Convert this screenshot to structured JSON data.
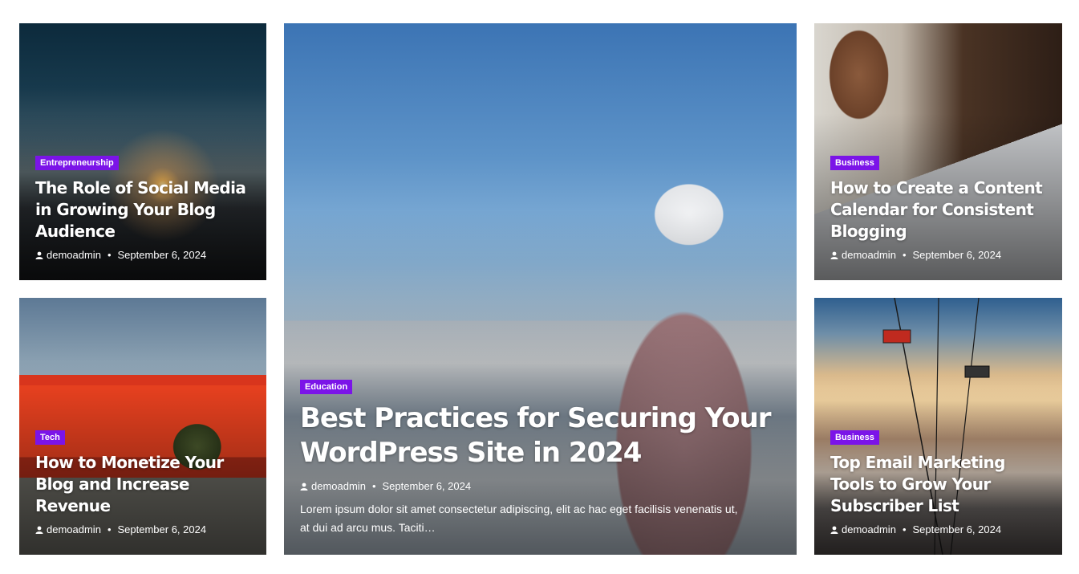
{
  "posts": {
    "top_left": {
      "category": "Entrepreneurship",
      "title": "The Role of Social Media in Growing Your Blog Audience",
      "author": "demoadmin",
      "date": "September 6, 2024"
    },
    "bottom_left": {
      "category": "Tech",
      "title": "How to Monetize Your Blog and Increase Revenue",
      "author": "demoadmin",
      "date": "September 6, 2024"
    },
    "featured": {
      "category": "Education",
      "title": "Best Practices for Securing Your WordPress Site in 2024",
      "author": "demoadmin",
      "date": "September 6, 2024",
      "excerpt": "Lorem ipsum dolor sit amet consectetur adipiscing, elit ac hac eget facilisis venenatis ut, at dui ad arcu mus. Taciti…"
    },
    "top_right": {
      "category": "Business",
      "title": "How to Create a Content Calendar for Consistent Blogging",
      "author": "demoadmin",
      "date": "September 6, 2024"
    },
    "bottom_right": {
      "category": "Business",
      "title": "Top Email Marketing Tools to Grow Your Subscriber List",
      "author": "demoadmin",
      "date": "September 6, 2024"
    }
  },
  "colors": {
    "category_badge": "#7b14e8",
    "text": "#ffffff"
  },
  "icons": {
    "author": "user-icon"
  }
}
